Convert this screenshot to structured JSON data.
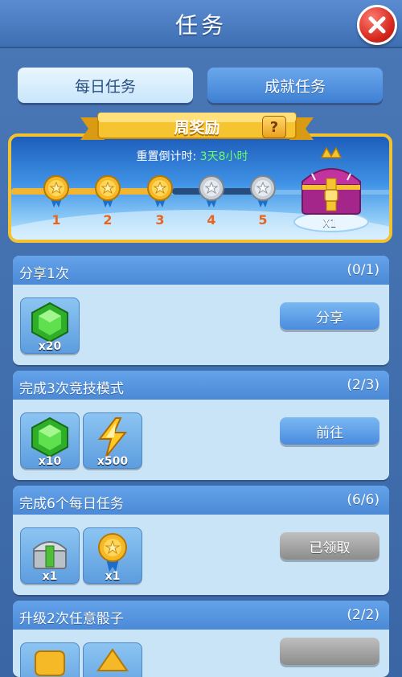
{
  "title": "任务",
  "tabs": [
    {
      "label": "每日任务",
      "active": true
    },
    {
      "label": "成就任务",
      "active": false
    }
  ],
  "weekly_reward": {
    "banner": "周奖励",
    "help": "?",
    "countdown_label": "重置倒计时:",
    "countdown_value": "3天8小时",
    "milestones": [
      {
        "label": "1",
        "reached": true
      },
      {
        "label": "2",
        "reached": true
      },
      {
        "label": "3",
        "reached": true
      },
      {
        "label": "4",
        "reached": false
      },
      {
        "label": "5",
        "reached": false
      }
    ],
    "chest_qty": "X1"
  },
  "tasks": [
    {
      "name": "分享1次",
      "progress": "(0/1)",
      "rewards": [
        {
          "icon": "green-gem-icon",
          "qty": "x20"
        }
      ],
      "action": "分享",
      "action_state": "active"
    },
    {
      "name": "完成3次竞技模式",
      "progress": "(2/3)",
      "rewards": [
        {
          "icon": "green-gem-icon",
          "qty": "x10"
        },
        {
          "icon": "lightning-icon",
          "qty": "x500"
        }
      ],
      "action": "前往",
      "action_state": "active"
    },
    {
      "name": "完成6个每日任务",
      "progress": "(6/6)",
      "rewards": [
        {
          "icon": "silver-chest-icon",
          "qty": "x1"
        },
        {
          "icon": "gold-medal-icon",
          "qty": "x1"
        }
      ],
      "action": "已领取",
      "action_state": "claimed"
    },
    {
      "name": "升级2次任意骰子",
      "progress": "(2/2)",
      "rewards": [],
      "action": "",
      "action_state": "hidden"
    }
  ],
  "colors": {
    "accent_gold": "#f3c231",
    "countdown_green": "#6cff64",
    "close_red": "#d3261c"
  }
}
